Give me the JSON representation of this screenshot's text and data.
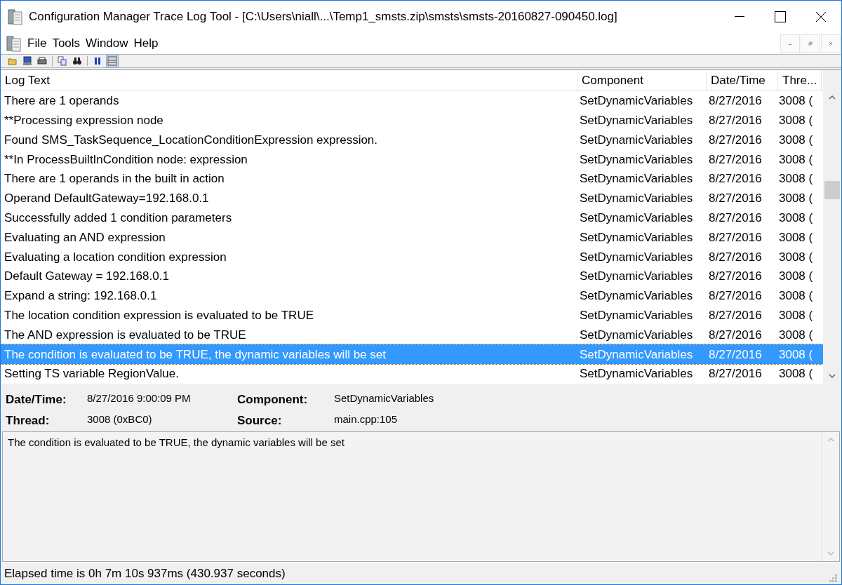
{
  "window": {
    "title": "Configuration Manager Trace Log Tool - [C:\\Users\\niall\\...\\Temp1_smsts.zip\\smsts\\smsts-20160827-090450.log]"
  },
  "menu": [
    "File",
    "Tools",
    "Window",
    "Help"
  ],
  "toolbar": [
    {
      "kind": "open",
      "selected": false
    },
    {
      "kind": "monitor",
      "selected": false
    },
    {
      "kind": "print",
      "selected": false
    },
    {
      "kind": "copy",
      "selected": false
    },
    {
      "kind": "find",
      "selected": false
    },
    {
      "kind": "pause",
      "selected": false
    },
    {
      "kind": "details",
      "selected": true
    }
  ],
  "table": {
    "columns": [
      "Log Text",
      "Component",
      "Date/Time",
      "Thre..."
    ],
    "rows": [
      {
        "text": "There are 1 operands",
        "component": "SetDynamicVariables",
        "datetime": "8/27/2016",
        "thread": "3008 (",
        "selected": false
      },
      {
        "text": "**Processing expression node",
        "component": "SetDynamicVariables",
        "datetime": "8/27/2016",
        "thread": "3008 (",
        "selected": false
      },
      {
        "text": "Found SMS_TaskSequence_LocationConditionExpression expression.",
        "component": "SetDynamicVariables",
        "datetime": "8/27/2016",
        "thread": "3008 (",
        "selected": false
      },
      {
        "text": "**In ProcessBuiltInCondition node: expression",
        "component": "SetDynamicVariables",
        "datetime": "8/27/2016",
        "thread": "3008 (",
        "selected": false
      },
      {
        "text": "There are 1 operands in the built in action",
        "component": "SetDynamicVariables",
        "datetime": "8/27/2016",
        "thread": "3008 (",
        "selected": false
      },
      {
        "text": "Operand DefaultGateway=192.168.0.1",
        "component": "SetDynamicVariables",
        "datetime": "8/27/2016",
        "thread": "3008 (",
        "selected": false
      },
      {
        "text": "Successfully added 1 condition parameters",
        "component": "SetDynamicVariables",
        "datetime": "8/27/2016",
        "thread": "3008 (",
        "selected": false
      },
      {
        "text": "Evaluating an AND expression",
        "component": "SetDynamicVariables",
        "datetime": "8/27/2016",
        "thread": "3008 (",
        "selected": false
      },
      {
        "text": "Evaluating a location condition expression",
        "component": "SetDynamicVariables",
        "datetime": "8/27/2016",
        "thread": "3008 (",
        "selected": false
      },
      {
        "text": "Default Gateway = 192.168.0.1",
        "component": "SetDynamicVariables",
        "datetime": "8/27/2016",
        "thread": "3008 (",
        "selected": false
      },
      {
        "text": "Expand a string: 192.168.0.1",
        "component": "SetDynamicVariables",
        "datetime": "8/27/2016",
        "thread": "3008 (",
        "selected": false
      },
      {
        "text": "The location condition expression is evaluated to be TRUE",
        "component": "SetDynamicVariables",
        "datetime": "8/27/2016",
        "thread": "3008 (",
        "selected": false
      },
      {
        "text": "The AND expression is evaluated to be TRUE",
        "component": "SetDynamicVariables",
        "datetime": "8/27/2016",
        "thread": "3008 (",
        "selected": false
      },
      {
        "text": "The condition is evaluated to be TRUE, the dynamic variables will be set",
        "component": "SetDynamicVariables",
        "datetime": "8/27/2016",
        "thread": "3008 (",
        "selected": true
      },
      {
        "text": "Setting TS variable RegionValue.",
        "component": "SetDynamicVariables",
        "datetime": "8/27/2016",
        "thread": "3008 (",
        "selected": false
      }
    ]
  },
  "details": {
    "fields": [
      {
        "label": "Date/Time:",
        "value": "8/27/2016 9:00:09 PM"
      },
      {
        "label": "Component:",
        "value": "SetDynamicVariables"
      },
      {
        "label": "Thread:",
        "value": "3008 (0xBC0)"
      },
      {
        "label": "Source:",
        "value": "main.cpp:105"
      }
    ],
    "message": "The condition is evaluated to be TRUE, the dynamic variables will be set"
  },
  "status_bar": "Elapsed time is 0h 7m 10s 937ms (430.937 seconds)"
}
